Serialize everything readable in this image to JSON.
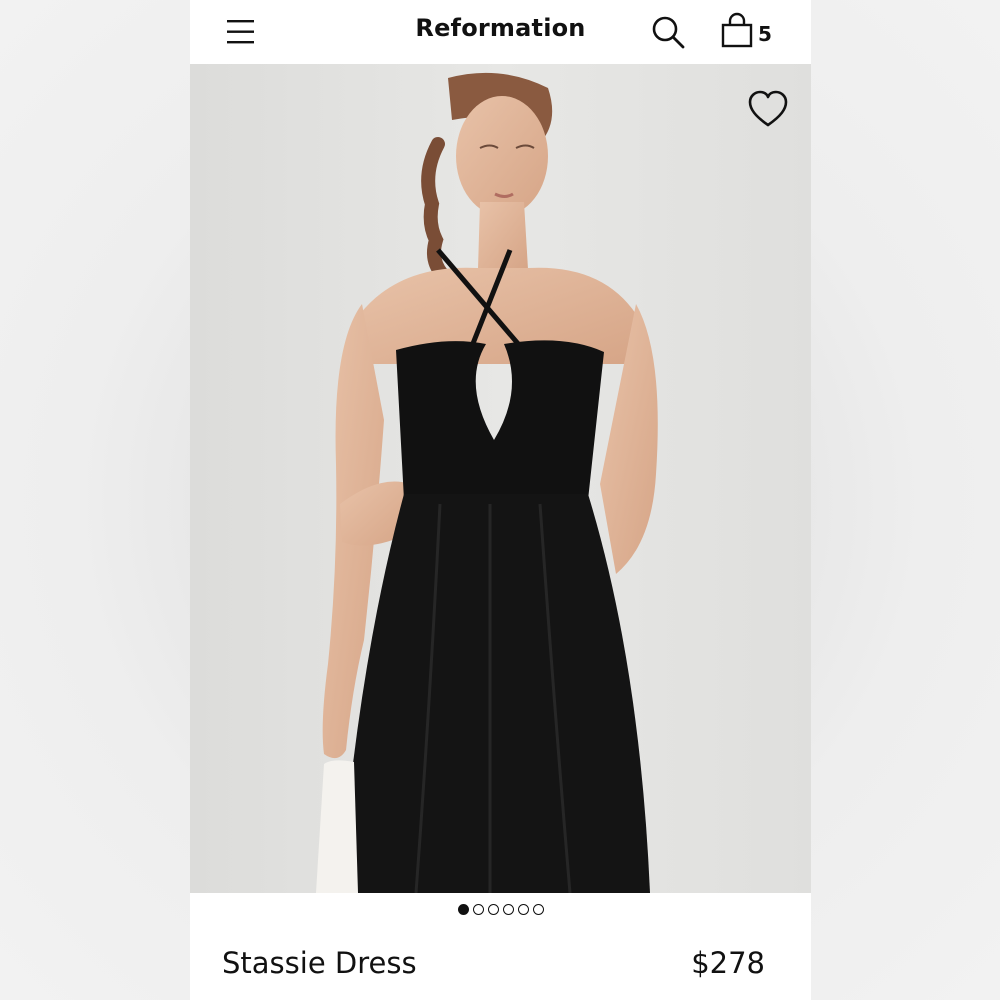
{
  "header": {
    "brand": "Reformation",
    "menu_icon": "hamburger-menu-icon",
    "search_icon": "search-icon",
    "bag_icon": "shopping-bag-icon",
    "bag_count": "5"
  },
  "gallery": {
    "favorite_icon": "heart-outline-icon",
    "image_subject": "model wearing black halter cutout midi dress",
    "slide_count": 6,
    "active_slide": 1
  },
  "product": {
    "name": "Stassie Dress",
    "price": "$278"
  },
  "colors": {
    "background": "#ffffff",
    "text": "#111111",
    "photo_background": "#e3e3e1",
    "dress": "#111111"
  }
}
